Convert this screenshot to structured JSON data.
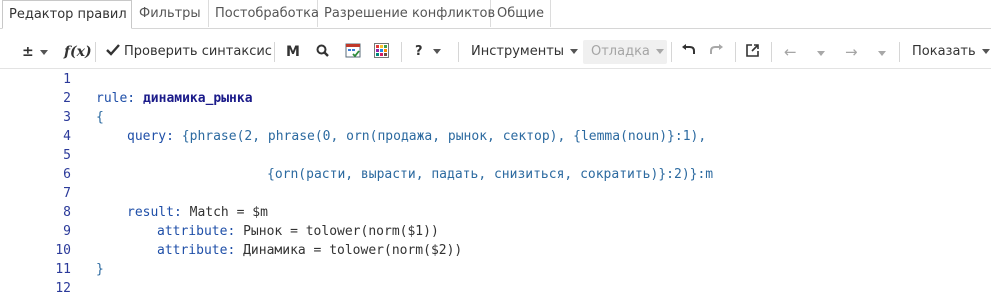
{
  "tabs": [
    "Редактор правил",
    "Фильтры",
    "Постобработка",
    "Разрешение конфликтов",
    "Общие"
  ],
  "toolbar": {
    "plusminus": "±",
    "fx": "f(x)",
    "check_syntax": "Проверить синтаксис",
    "m_label": "M",
    "help": "?",
    "tools": "Инструменты",
    "debug": "Отладка",
    "show": "Показать"
  },
  "editor": {
    "line_numbers": [
      "1",
      "2",
      "3",
      "4",
      "5",
      "6",
      "7",
      "8",
      "9",
      "10",
      "11",
      "12"
    ],
    "l2_kw": "rule:",
    "l2_name": "динамика_рынка",
    "l3": "{",
    "l4_kw": "query:",
    "l4_rest": "{phrase(2, phrase(0, orn(продажа, рынок, сектор), {lemma(noun)}:1),",
    "l6": "{orn(расти, вырасти, падать, снизиться, сократить)}:2)}:m",
    "l8_kw": "result:",
    "l8_rest": "Match = $m",
    "l9_kw": "attribute:",
    "l9_rest": "Рынок = tolower(norm($1))",
    "l10_kw": "attribute:",
    "l10_rest": "Динамика = tolower(norm($2))",
    "l11": "}"
  }
}
